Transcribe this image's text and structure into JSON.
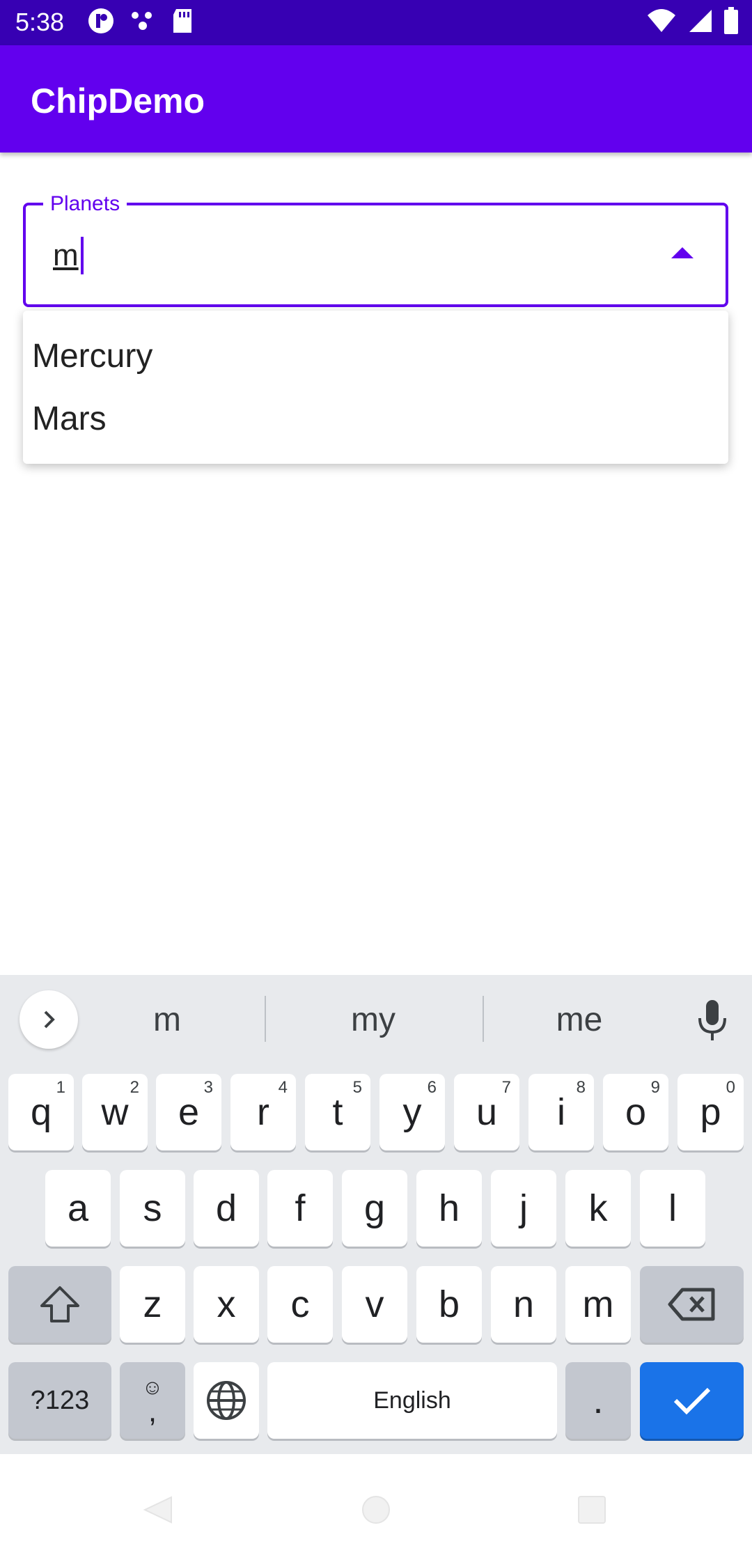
{
  "status_bar": {
    "time": "5:38",
    "icons": [
      "app-notification-icon",
      "dots-icon",
      "sd-card-icon",
      "wifi-icon",
      "signal-icon",
      "battery-icon"
    ]
  },
  "app_bar": {
    "title": "ChipDemo",
    "color": "#6200ee"
  },
  "planets_field": {
    "label": "Planets",
    "value": "m",
    "accent_color": "#6200ee",
    "dropdown_state": "expanded"
  },
  "dropdown": {
    "items": [
      "Mercury",
      "Mars"
    ]
  },
  "keyboard": {
    "suggestions": [
      "m",
      "my",
      "me"
    ],
    "row1": [
      {
        "key": "q",
        "hint": "1"
      },
      {
        "key": "w",
        "hint": "2"
      },
      {
        "key": "e",
        "hint": "3"
      },
      {
        "key": "r",
        "hint": "4"
      },
      {
        "key": "t",
        "hint": "5"
      },
      {
        "key": "y",
        "hint": "6"
      },
      {
        "key": "u",
        "hint": "7"
      },
      {
        "key": "i",
        "hint": "8"
      },
      {
        "key": "o",
        "hint": "9"
      },
      {
        "key": "p",
        "hint": "0"
      }
    ],
    "row2": [
      "a",
      "s",
      "d",
      "f",
      "g",
      "h",
      "j",
      "k",
      "l"
    ],
    "row3": [
      "z",
      "x",
      "c",
      "v",
      "b",
      "n",
      "m"
    ],
    "symbols_label": "?123",
    "comma_label": ",",
    "space_label": "English",
    "period_label": ".",
    "done_color": "#1a73e8"
  }
}
